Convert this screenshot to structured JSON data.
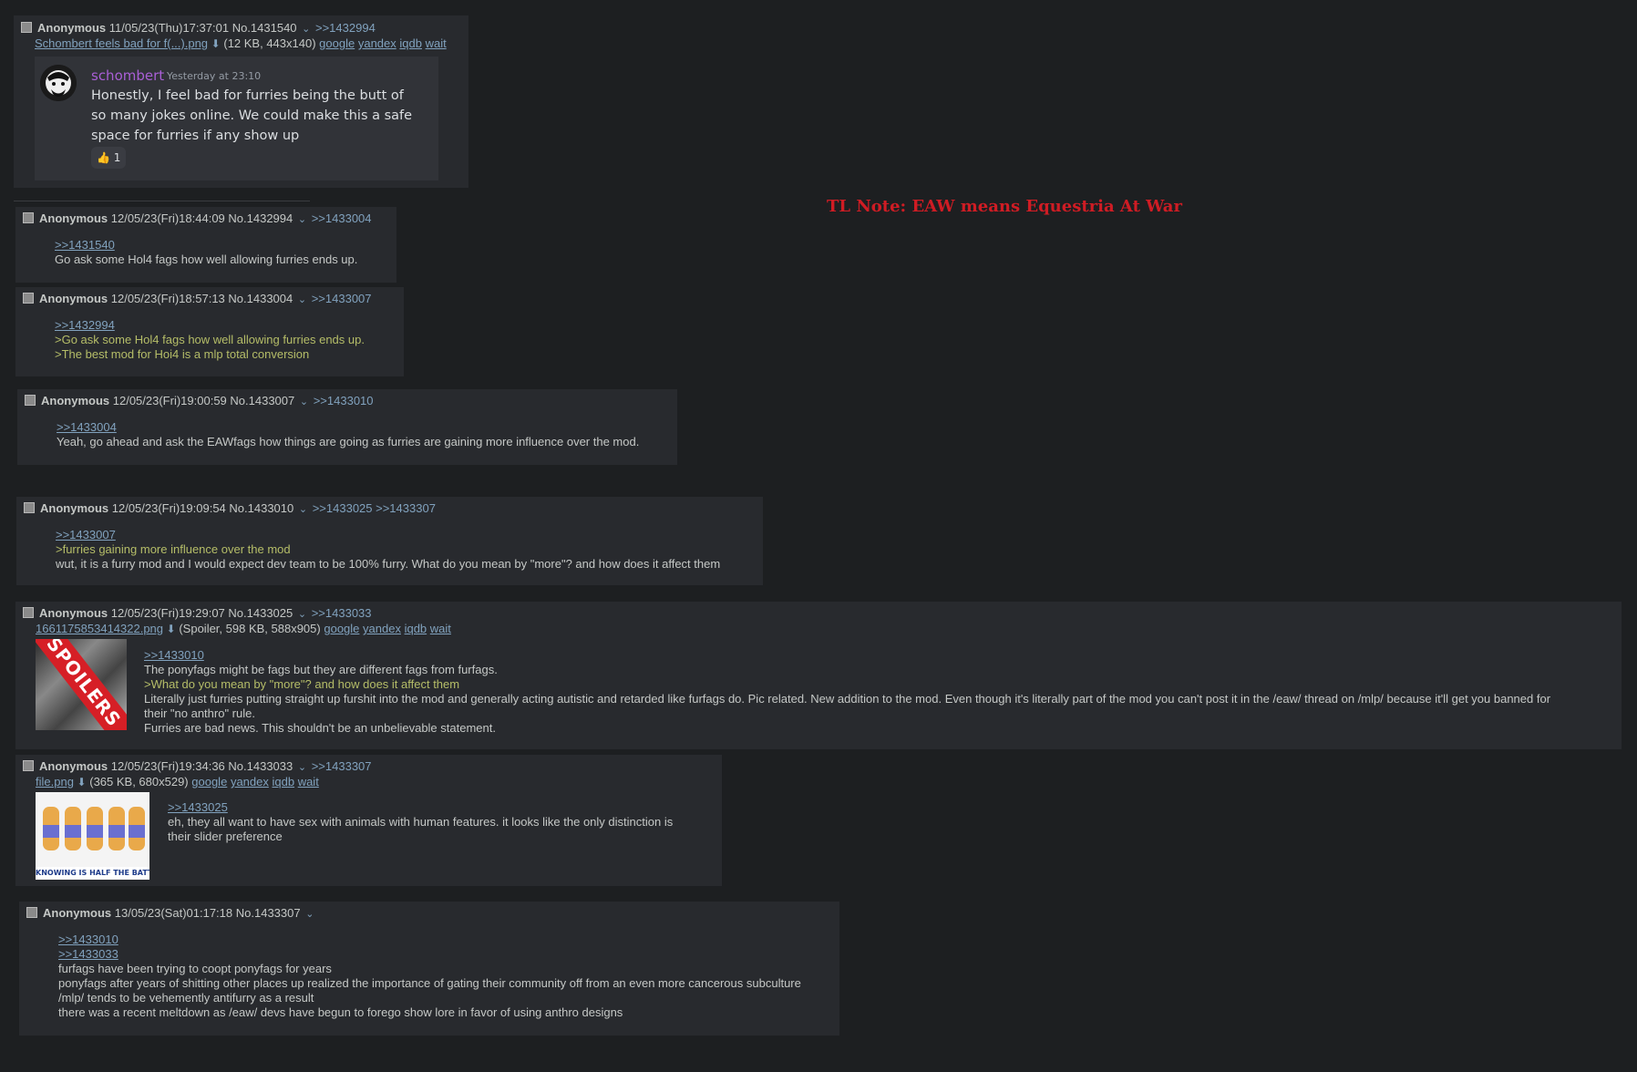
{
  "note": "TL Note: EAW means Equestria At War",
  "posts": [
    {
      "name": "Anonymous",
      "datetime": "11/05/23(Thu)17:37:01",
      "no": "No.1431540",
      "backlinks": ">>1432994",
      "file": {
        "name": "Schombert feels bad for f(...).png",
        "info": "(12 KB, 443x140)"
      },
      "search": [
        "google",
        "yandex",
        "iqdb",
        "wait"
      ],
      "discord": {
        "author": "schombert",
        "time": "Yesterday at 23:10",
        "message": "Honestly, I feel bad for furries being the butt of so many jokes online. We could make this a safe space for furries if any show up",
        "reaction_icon": "thumbs-up-icon",
        "reaction_count": "1"
      }
    },
    {
      "name": "Anonymous",
      "datetime": "12/05/23(Fri)18:44:09",
      "no": "No.1432994",
      "backlinks": ">>1433004",
      "lines": [
        ">>1431540",
        "Go ask some Hol4 fags how well allowing furries ends up."
      ]
    },
    {
      "name": "Anonymous",
      "datetime": "12/05/23(Fri)18:57:13",
      "no": "No.1433004",
      "backlinks": ">>1433007",
      "lines": [
        ">>1432994",
        ">Go ask some Hol4 fags how well allowing furries ends up.",
        ">The best mod for Hoi4 is a mlp total conversion"
      ]
    },
    {
      "name": "Anonymous",
      "datetime": "12/05/23(Fri)19:00:59",
      "no": "No.1433007",
      "backlinks": ">>1433010",
      "lines": [
        ">>1433004",
        "Yeah, go ahead and ask the EAWfags how things are going as furries are gaining more influence over the mod."
      ]
    },
    {
      "name": "Anonymous",
      "datetime": "12/05/23(Fri)19:09:54",
      "no": "No.1433010",
      "backlinks": ">>1433025 >>1433307",
      "lines": [
        ">>1433007",
        ">furries gaining more influence over the mod",
        "wut, it is a furry mod and I would expect dev team to be 100% furry. What do you mean by \"more\"? and how does it affect them"
      ]
    },
    {
      "name": "Anonymous",
      "datetime": "12/05/23(Fri)19:29:07",
      "no": "No.1433025",
      "backlinks": ">>1433033",
      "file": {
        "name": "1661175853414322.png",
        "info": "(Spoiler, 598 KB, 588x905)"
      },
      "search": [
        "google",
        "yandex",
        "iqdb",
        "wait"
      ],
      "thumb_text": "SPOILERS",
      "lines": [
        ">>1433010",
        "The ponyfags might be fags but they are different fags from furfags.",
        ">What do you mean by \"more\"? and how does it affect them",
        "Literally just furries putting straight up furshit into the mod and generally acting autistic and retarded like furfags do. Pic related. New addition to the mod. Even though it's literally part of the mod you can't post it in the /eaw/ thread on /mlp/ because it'll get you banned for their \"no anthro\" rule.",
        "Furries are bad news. This shouldn't be an unbelievable statement."
      ]
    },
    {
      "name": "Anonymous",
      "datetime": "12/05/23(Fri)19:34:36",
      "no": "No.1433033",
      "backlinks": ">>1433307",
      "file": {
        "name": "file.png",
        "info": "(365 KB, 680x529)"
      },
      "search": [
        "google",
        "yandex",
        "iqdb",
        "wait"
      ],
      "thumb_text": "KNOWING IS HALF THE BATTLE",
      "lines": [
        ">>1433025",
        "eh, they all want to have sex with animals with human features. it looks like the only distinction is their slider preference"
      ]
    },
    {
      "name": "Anonymous",
      "datetime": "13/05/23(Sat)01:17:18",
      "no": "No.1433307",
      "backlinks": "",
      "lines": [
        ">>1433010",
        ">>1433033",
        "furfags have been trying to coopt ponyfags for years",
        "ponyfags after years of shitting other places up realized the importance of gating their community off from an even more cancerous subculture",
        "/mlp/ tends to be vehemently antifurry as a result",
        "there was a recent meltdown as /eaw/ devs have begun to forego show lore in favor of using anthro designs"
      ]
    }
  ]
}
